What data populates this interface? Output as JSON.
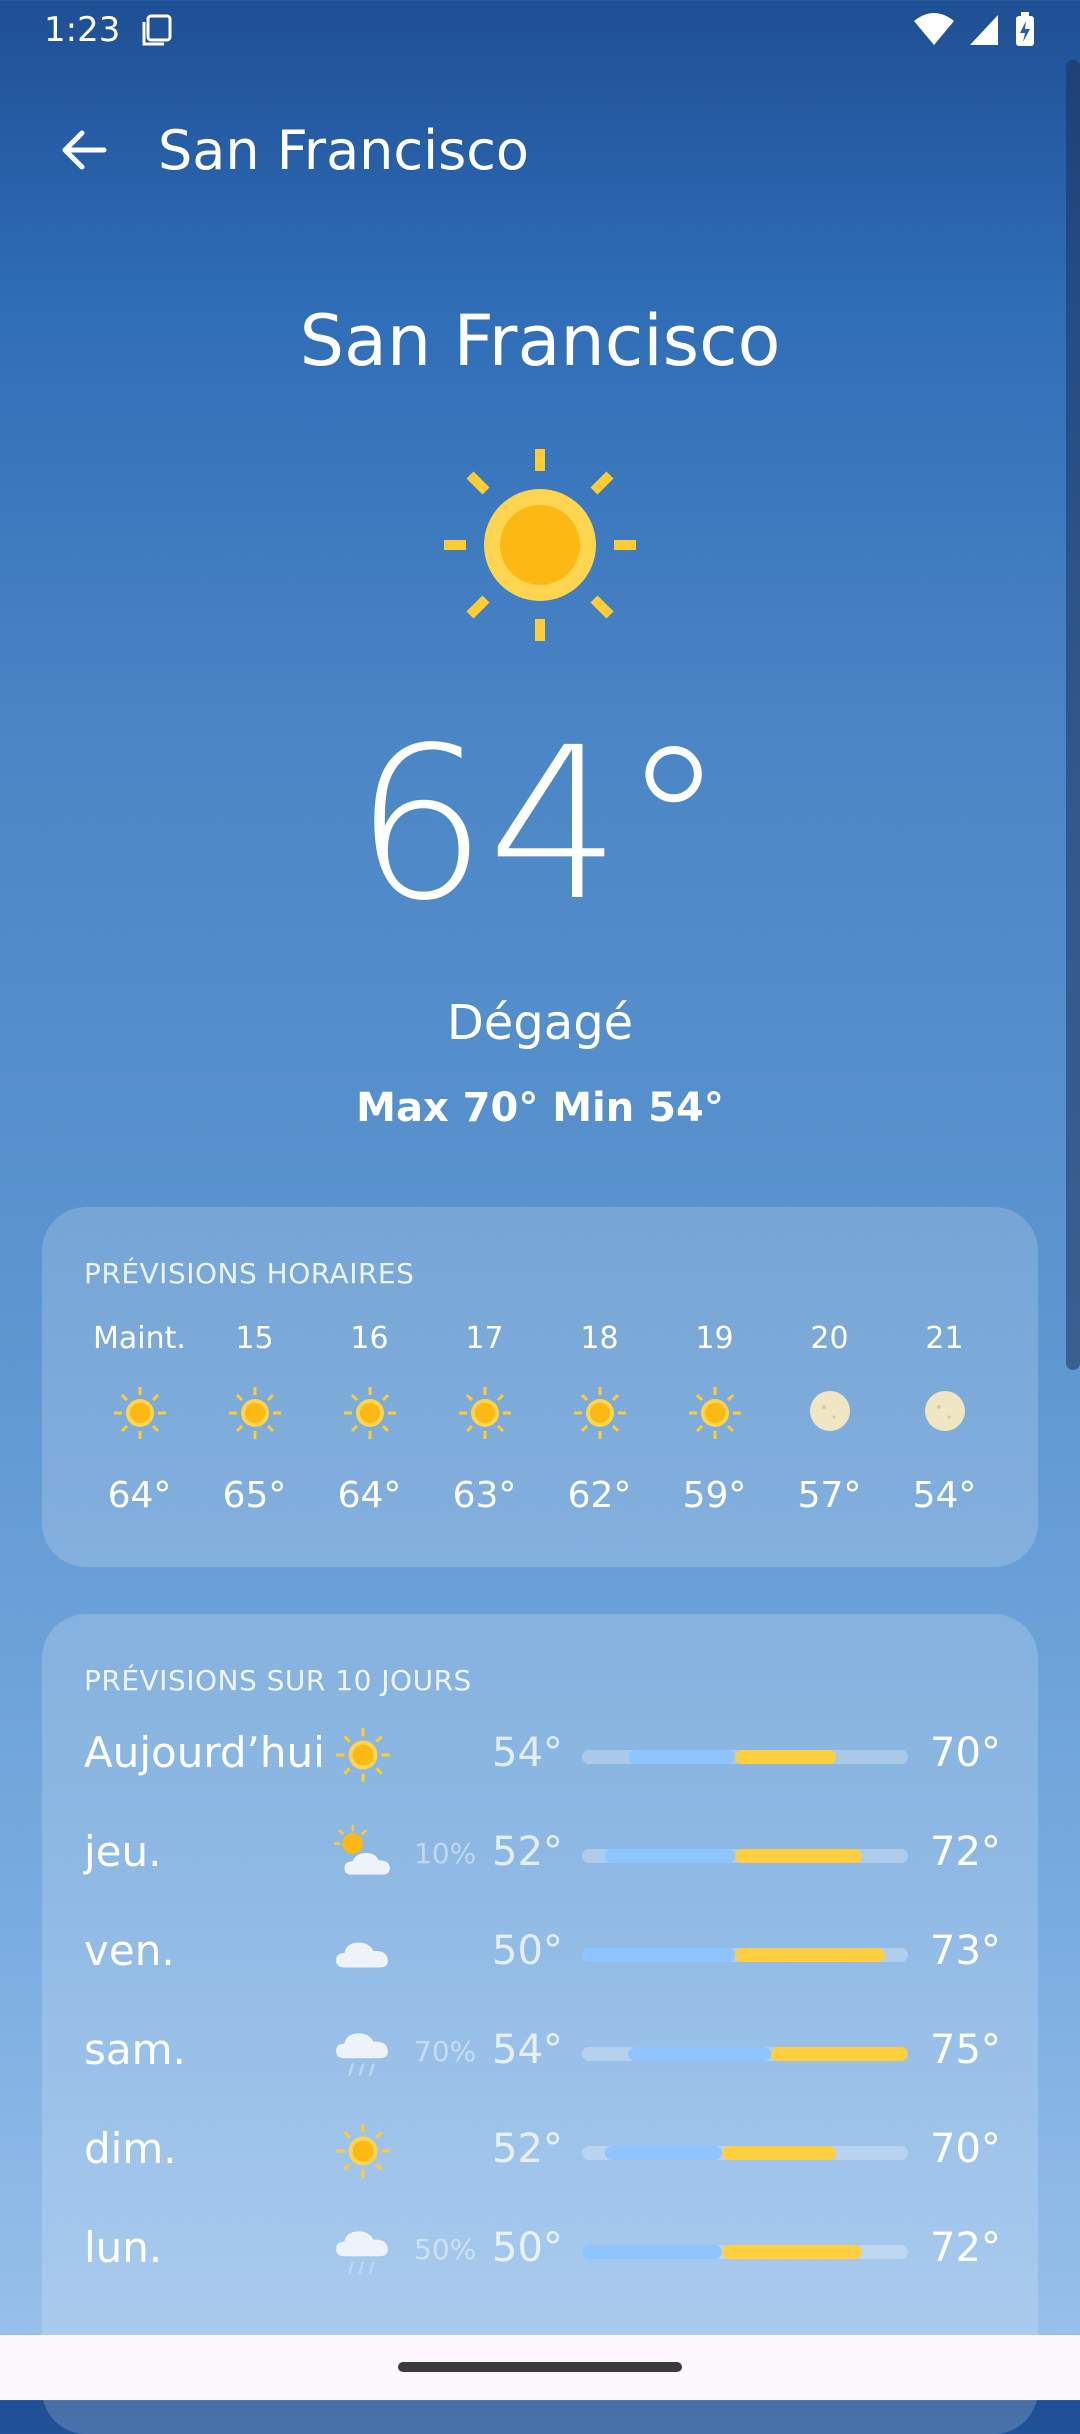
{
  "status": {
    "time": "1:23"
  },
  "appbar": {
    "title": "San Francisco"
  },
  "current": {
    "city": "San Francisco",
    "temp": "64°",
    "condition": "Dégagé",
    "range": "Max 70° Min 54°",
    "icon": "sun-icon"
  },
  "hourly": {
    "title": "PRÉVISIONS HORAIRES",
    "items": [
      {
        "label": "Maint.",
        "temp": "64°",
        "icon": "sun-icon"
      },
      {
        "label": "15",
        "temp": "65°",
        "icon": "sun-icon"
      },
      {
        "label": "16",
        "temp": "64°",
        "icon": "sun-icon"
      },
      {
        "label": "17",
        "temp": "63°",
        "icon": "sun-icon"
      },
      {
        "label": "18",
        "temp": "62°",
        "icon": "sun-icon"
      },
      {
        "label": "19",
        "temp": "59°",
        "icon": "sun-icon"
      },
      {
        "label": "20",
        "temp": "57°",
        "icon": "moon-icon"
      },
      {
        "label": "21",
        "temp": "54°",
        "icon": "moon-icon"
      }
    ]
  },
  "daily": {
    "title": "PRÉVISIONS SUR 10 JOURS",
    "items": [
      {
        "day": "Aujourd’hui",
        "icon": "sun-icon",
        "precip": "",
        "low": "54°",
        "high": "70°",
        "range_start": 0.14,
        "blue_end": 0.47,
        "range_end": 0.78
      },
      {
        "day": "jeu.",
        "icon": "partly-cloudy-icon",
        "precip": "10%",
        "low": "52°",
        "high": "72°",
        "range_start": 0.07,
        "blue_end": 0.47,
        "range_end": 0.86
      },
      {
        "day": "ven.",
        "icon": "cloud-icon",
        "precip": "",
        "low": "50°",
        "high": "73°",
        "range_start": 0.0,
        "blue_end": 0.47,
        "range_end": 0.93
      },
      {
        "day": "sam.",
        "icon": "rain-icon",
        "precip": "70%",
        "low": "54°",
        "high": "75°",
        "range_start": 0.14,
        "blue_end": 0.58,
        "range_end": 1.0
      },
      {
        "day": "dim.",
        "icon": "sun-icon",
        "precip": "",
        "low": "52°",
        "high": "70°",
        "range_start": 0.07,
        "blue_end": 0.43,
        "range_end": 0.78
      },
      {
        "day": "lun.",
        "icon": "rain-icon",
        "precip": "50%",
        "low": "50°",
        "high": "72°",
        "range_start": 0.0,
        "blue_end": 0.43,
        "range_end": 0.86
      }
    ]
  },
  "colors": {
    "sun": "#FDB813",
    "sun_ray": "#FFCC33",
    "bar_blue": "#8EC5FF",
    "bar_yellow": "#FFCF3F",
    "moon": "#F1E6C4"
  }
}
